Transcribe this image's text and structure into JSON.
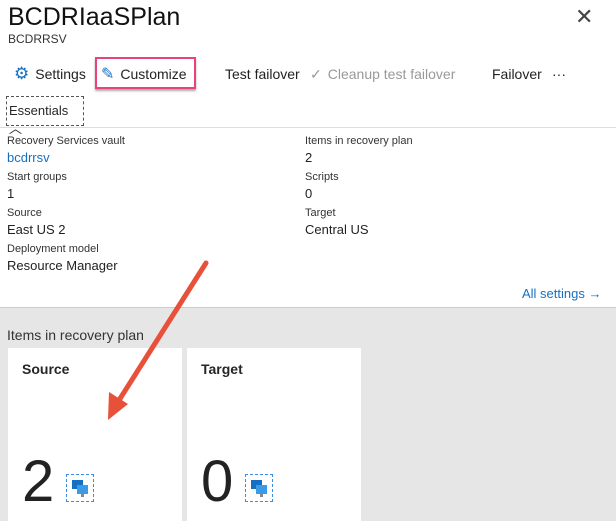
{
  "header": {
    "title": "BCDRIaaSPlan",
    "subtitle": "BCDRRSV",
    "close_icon": "close-icon"
  },
  "toolbar": {
    "settings": "Settings",
    "customize": "Customize",
    "test_failover": "Test failover",
    "cleanup": "Cleanup test failover",
    "failover": "Failover",
    "more": "···"
  },
  "essentials": {
    "label": "Essentials",
    "left": [
      {
        "label": "Recovery Services vault",
        "value": "bcdrrsv"
      },
      {
        "label": "Start groups",
        "value": "1"
      },
      {
        "label": "Source",
        "value": "East US 2"
      },
      {
        "label": "Deployment model",
        "value": "Resource Manager"
      }
    ],
    "right": [
      {
        "label": "Items in recovery plan",
        "value": "2"
      },
      {
        "label": "Scripts",
        "value": "0"
      },
      {
        "label": "Target",
        "value": "Central US"
      }
    ],
    "all_settings": "All settings →"
  },
  "items": {
    "heading": "Items in recovery plan",
    "tiles": [
      {
        "title": "Source",
        "count": "2"
      },
      {
        "title": "Target",
        "count": "0"
      }
    ]
  },
  "colors": {
    "accent": "#1570c4",
    "highlight": "#e8437a",
    "arrow": "#e8503a"
  }
}
